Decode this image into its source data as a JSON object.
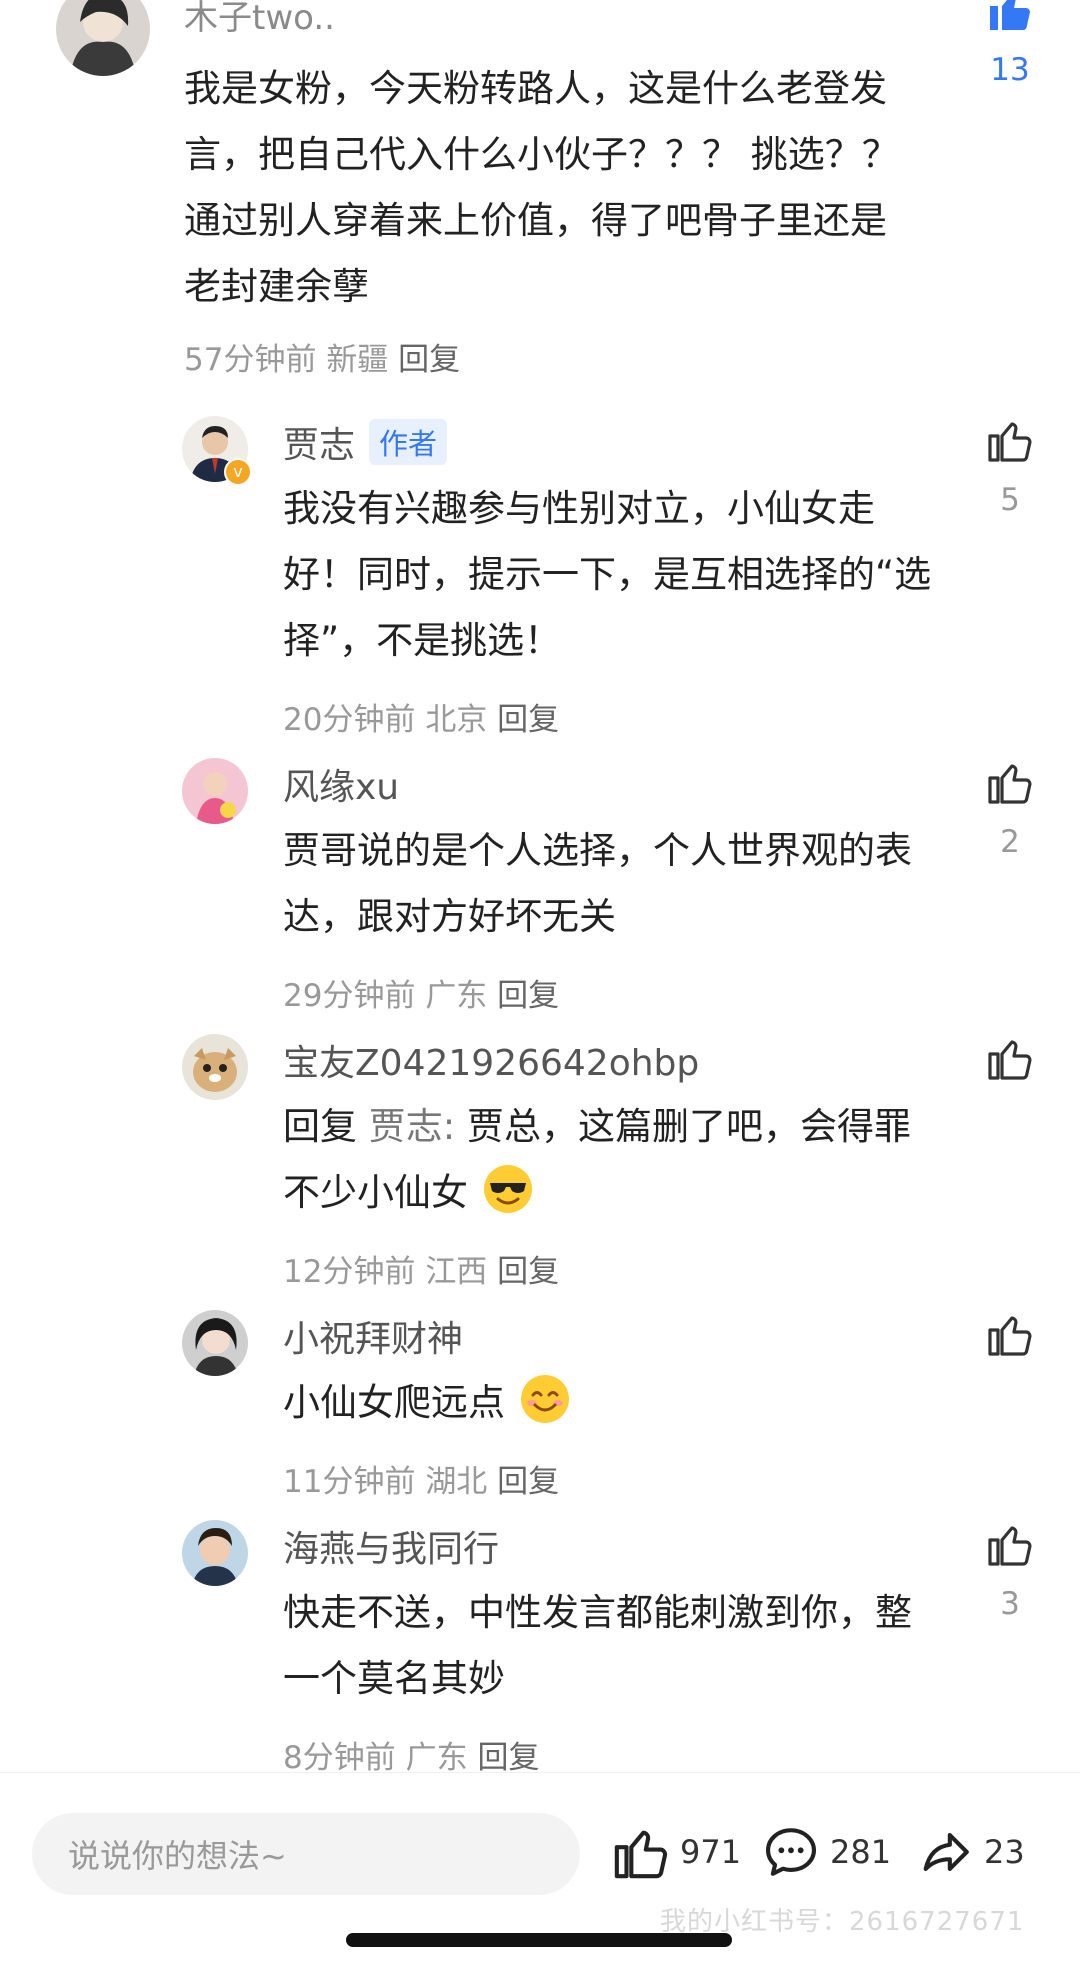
{
  "main_comment": {
    "username": "木子two..",
    "text_lines": [
      "我是女粉，今天粉转路人，这是什么老登发",
      "言，把自己代入什么小伙子？？？ 挑选？？",
      "通过别人穿着来上价值，得了吧骨子里还是",
      "老封建余孽"
    ],
    "time": "57分钟前",
    "location": "新疆",
    "reply_label": "回复",
    "likes": "13"
  },
  "replies": [
    {
      "username": "贾志",
      "badge": "作者",
      "text_lines": [
        "我没有兴趣参与性别对立，小仙女走",
        "好！同时，提示一下，是互相选择的“选",
        "择”，不是挑选！"
      ],
      "time": "20分钟前",
      "location": "北京",
      "reply_label": "回复",
      "likes": "5"
    },
    {
      "username": "风缘xu",
      "text_lines": [
        "贾哥说的是个人选择，个人世界观的表",
        "达，跟对方好坏无关"
      ],
      "time": "29分钟前",
      "location": "广东",
      "reply_label": "回复",
      "likes": "2"
    },
    {
      "username": "宝友Z0421926642ohbp",
      "reply_prefix": "回复",
      "reply_target": "贾志:",
      "text_lines": [
        "贾总，这篇删了吧，会得罪",
        "不少小仙女"
      ],
      "time": "12分钟前",
      "location": "江西",
      "reply_label": "回复",
      "likes": ""
    },
    {
      "username": "小祝拜财神",
      "text_lines": [
        "小仙女爬远点"
      ],
      "time": "11分钟前",
      "location": "湖北",
      "reply_label": "回复",
      "likes": ""
    },
    {
      "username": "海燕与我同行",
      "text_lines": [
        "快走不送，中性发言都能刺激到你，整",
        "一个莫名其妙"
      ],
      "time": "8分钟前",
      "location": "广东",
      "reply_label": "回复",
      "likes": "3"
    }
  ],
  "bottom_bar": {
    "input_placeholder": "说说你的想法~",
    "like_count": "971",
    "comment_count": "281",
    "share_count": "23"
  },
  "watermark": "我的小红书号：2616727671",
  "colors": {
    "accent_blue": "#3478f6",
    "meta_gray": "#999999",
    "badge_bg": "#e8f0fe"
  },
  "icons": [
    "thumb-up-icon",
    "comment-bubble-icon",
    "share-icon",
    "verified-icon",
    "sunglasses-emoji",
    "smile-emoji"
  ]
}
